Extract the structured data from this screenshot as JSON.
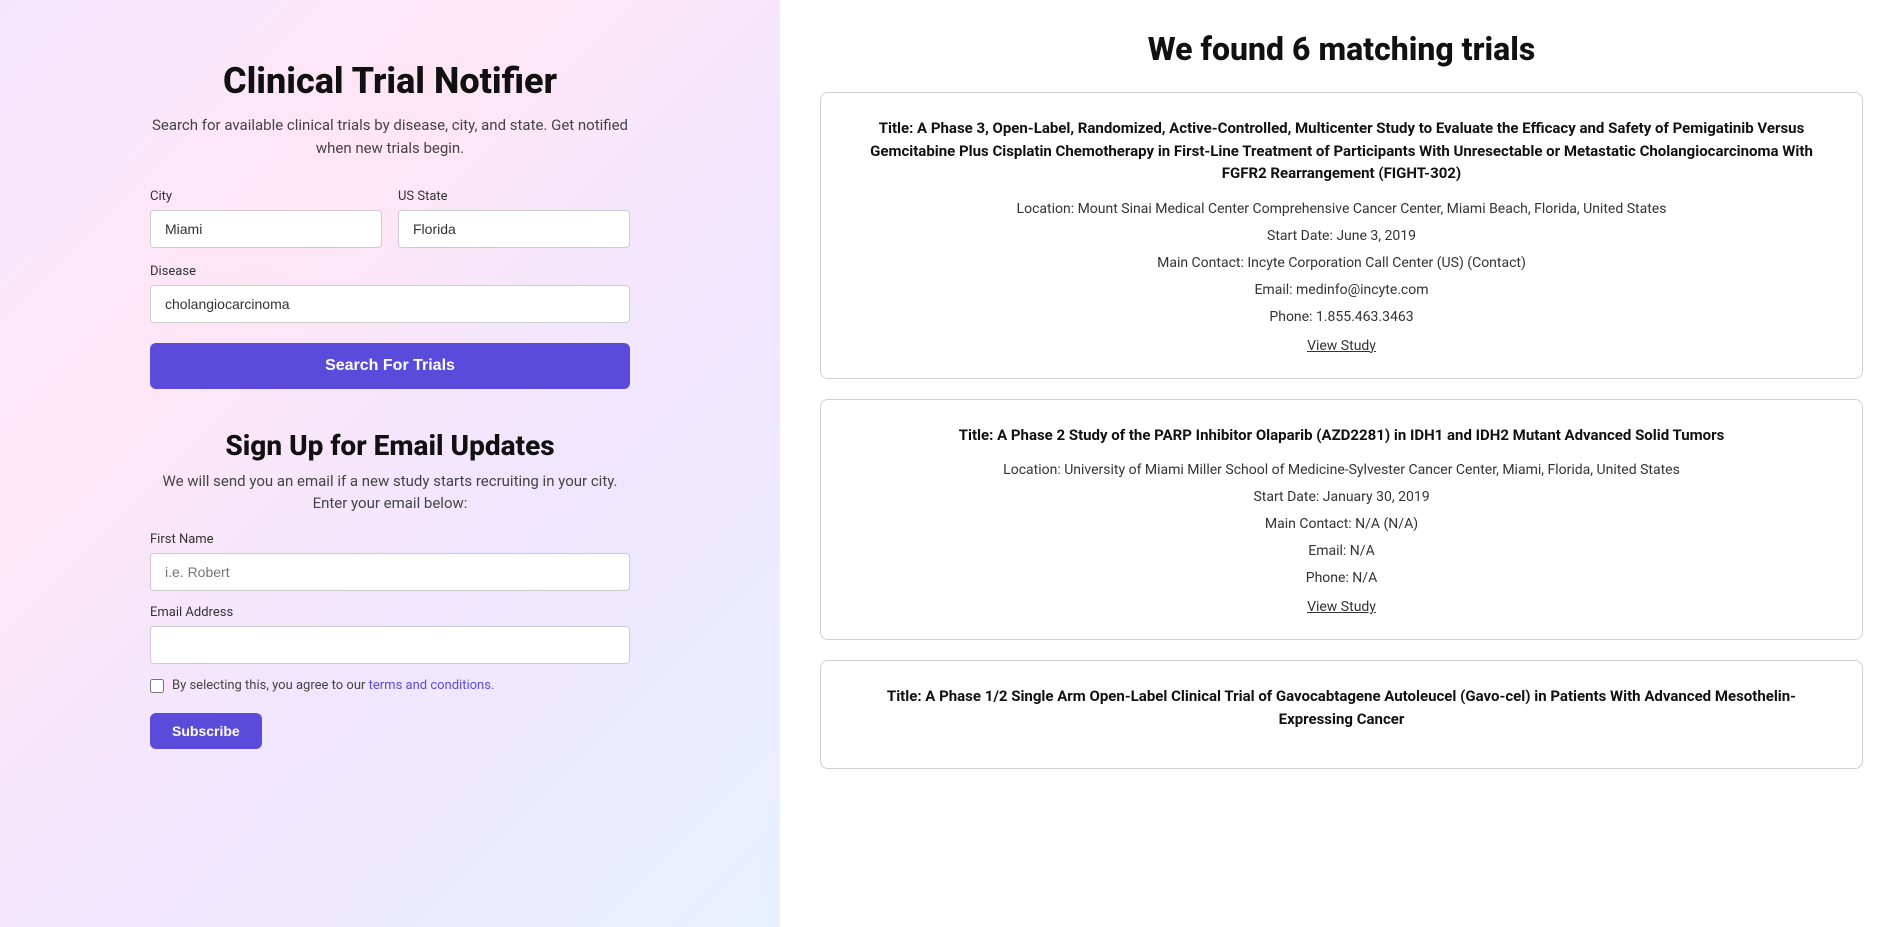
{
  "app": {
    "title": "Clinical Trial Notifier",
    "subtitle": "Search for available clinical trials by disease, city, and state. Get notified when new trials begin."
  },
  "search_form": {
    "city_label": "City",
    "city_value": "Miami",
    "state_label": "US State",
    "state_value": "Florida",
    "disease_label": "Disease",
    "disease_value": "cholangiocarcinoma",
    "search_button": "Search For Trials"
  },
  "signup_form": {
    "title": "Sign Up for Email Updates",
    "subtitle": "We will send you an email if a new study starts recruiting in your city.",
    "subtitle2": "Enter your email below:",
    "firstname_label": "First Name",
    "firstname_placeholder": "i.e. Robert",
    "email_label": "Email Address",
    "email_placeholder": "",
    "checkbox_text": "By selecting this, you agree to our ",
    "terms_link": "terms and conditions.",
    "subscribe_button": "Subscribe"
  },
  "results": {
    "title": "We found 6 matching trials",
    "trials": [
      {
        "title": "Title: A Phase 3, Open-Label, Randomized, Active-Controlled, Multicenter Study to Evaluate the Efficacy and Safety of Pemigatinib Versus Gemcitabine Plus Cisplatin Chemotherapy in First-Line Treatment of Participants With Unresectable or Metastatic Cholangiocarcinoma With FGFR2 Rearrangement (FIGHT-302)",
        "location": "Location: Mount Sinai Medical Center Comprehensive Cancer Center, Miami Beach, Florida, United States",
        "start_date": "Start Date: June 3, 2019",
        "contact": "Main Contact: Incyte Corporation Call Center (US) (Contact)",
        "email": "Email: medinfo@incyte.com",
        "phone": "Phone: 1.855.463.3463",
        "view_study": "View Study"
      },
      {
        "title": "Title: A Phase 2 Study of the PARP Inhibitor Olaparib (AZD2281) in IDH1 and IDH2 Mutant Advanced Solid Tumors",
        "location": "Location: University of Miami Miller School of Medicine-Sylvester Cancer Center, Miami, Florida, United States",
        "start_date": "Start Date: January 30, 2019",
        "contact": "Main Contact: N/A (N/A)",
        "email": "Email: N/A",
        "phone": "Phone: N/A",
        "view_study": "View Study"
      },
      {
        "title": "Title: A Phase 1/2 Single Arm Open-Label Clinical Trial of Gavocabtagene Autoleucel (Gavo-cel) in Patients With Advanced Mesothelin-Expressing Cancer",
        "location": "",
        "start_date": "",
        "contact": "",
        "email": "",
        "phone": "",
        "view_study": ""
      }
    ]
  }
}
